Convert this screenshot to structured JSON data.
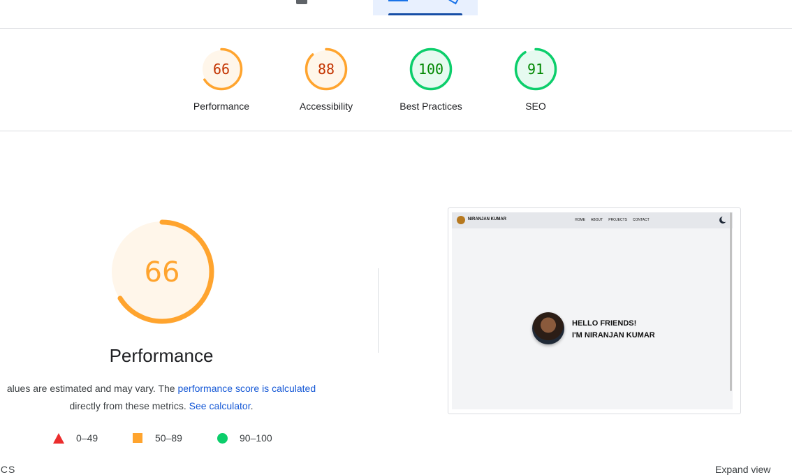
{
  "categories": [
    {
      "id": "performance",
      "label": "Performance",
      "score": "66",
      "status": "average"
    },
    {
      "id": "accessibility",
      "label": "Accessibility",
      "score": "88",
      "status": "average"
    },
    {
      "id": "best-practices",
      "label": "Best Practices",
      "score": "100",
      "status": "pass"
    },
    {
      "id": "seo",
      "label": "SEO",
      "score": "91",
      "status": "pass"
    }
  ],
  "performance": {
    "score": "66",
    "title": "Performance",
    "desc_prefix": "alues are estimated and may vary. The ",
    "desc_link1": "performance score is calculated",
    "desc_middle": "directly from these metrics. ",
    "desc_link2": "See calculator",
    "desc_suffix": "."
  },
  "legend": [
    {
      "shape": "triangle",
      "range": "0–49",
      "color": "#eb2d2d"
    },
    {
      "shape": "square",
      "range": "50–89",
      "color": "#ffa42e"
    },
    {
      "shape": "circle",
      "range": "90–100",
      "color": "#0cce6b"
    }
  ],
  "colors": {
    "average_fg": "#ffa42e",
    "average_bg": "#fff6ea",
    "average_text": "#c33300",
    "pass_fg": "#0cce6b",
    "pass_bg": "#e6faf0",
    "pass_text": "#008800"
  },
  "preview": {
    "brand": "NIRANJAN KUMAR",
    "nav_links": [
      "HOME",
      "ABOUT",
      "PROJECTS",
      "CONTACT"
    ],
    "hello_line1": "HELLO FRIENDS!",
    "hello_line2": "I'M NIRANJAN KUMAR"
  },
  "bottom": {
    "left_text": "ICS",
    "right_text": "Expand view"
  }
}
